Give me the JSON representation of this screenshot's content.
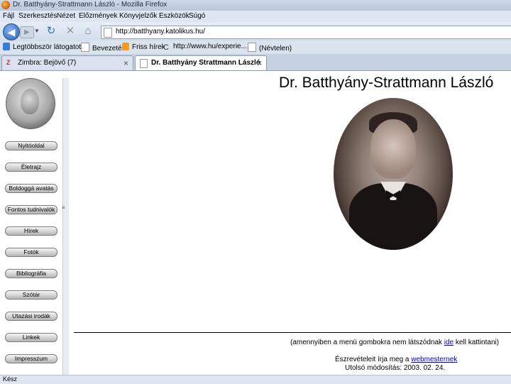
{
  "window": {
    "title": "Dr. Batthyány-Strattmann László - Mozilla Firefox"
  },
  "menu": [
    "Fájl",
    "Szerkesztés",
    "Nézet",
    "Előzmények",
    "Könyvjelzők",
    "Eszközök",
    "Súgó"
  ],
  "nav": {
    "url": "http://batthyany.katolikus.hu/"
  },
  "bookmarks": [
    "Legtöbbször látogatott",
    "Bevezetés",
    "Friss hírek",
    "http://www.hu/experie...",
    "(Névtelen)"
  ],
  "tabs": [
    {
      "label": "Zimbra: Bejövő (7)"
    },
    {
      "label": "Dr. Batthyány Strattmann László"
    }
  ],
  "sidebar": {
    "buttons": [
      "Nyitóoldal",
      "Életrajz",
      "Boldoggá avatás",
      "Fontos tudnivalók",
      "Hírek",
      "Fotók",
      "Bibliográfia",
      "Szótár",
      "Utazási irodák",
      "Linkek",
      "Impresszum"
    ]
  },
  "main": {
    "title": "Dr. Batthyány-Strattmann László",
    "note_prefix": "(amennyiben a menü gombokra nem látszódnak ",
    "note_link": "ide",
    "note_suffix": " kell kattintani)",
    "contact_prefix": "Észrevételeit írja meg a ",
    "contact_link": "webmesternek",
    "modified": "Utolsó módosítás: 2003. 02. 24."
  },
  "status": {
    "text": "Kész"
  },
  "icons": {
    "back": "back-arrow-icon",
    "forward": "forward-arrow-icon",
    "reload": "reload-icon",
    "stop": "stop-icon",
    "home": "home-icon"
  }
}
